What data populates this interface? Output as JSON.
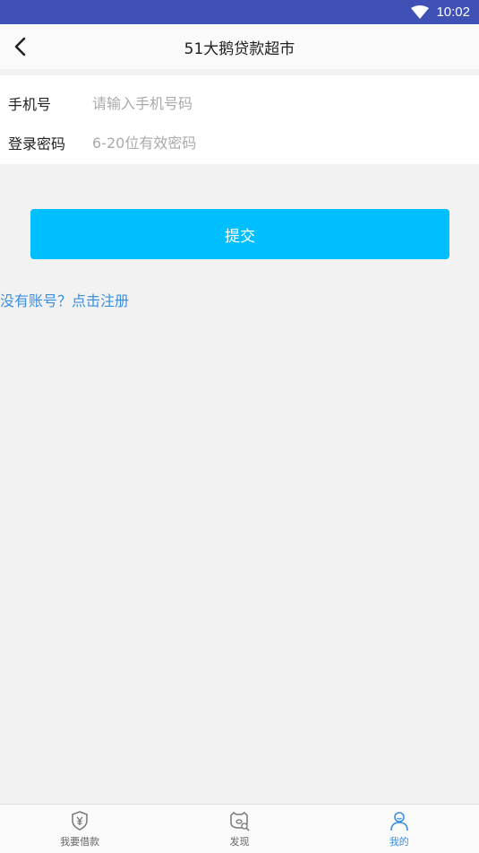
{
  "status_bar": {
    "time": "10:02",
    "wifi_icon": "wifi-icon"
  },
  "header": {
    "title": "51大鹅贷款超市",
    "back_icon": "chevron-left-icon"
  },
  "form": {
    "phone_label": "手机号",
    "phone_placeholder": "请输入手机号码",
    "phone_value": "",
    "password_label": "登录密码",
    "password_placeholder": "6-20位有效密码",
    "password_value": ""
  },
  "submit_label": "提交",
  "register_link": "没有账号？点击注册",
  "tabs": [
    {
      "label": "我要借款",
      "icon": "shield-yen-icon",
      "active": false
    },
    {
      "label": "发现",
      "icon": "discover-icon",
      "active": false
    },
    {
      "label": "我的",
      "icon": "person-icon",
      "active": true
    }
  ],
  "colors": {
    "status_bar": "#3f51b5",
    "accent": "#00bfff",
    "link": "#3b8fe0",
    "background": "#f2f2f2"
  }
}
